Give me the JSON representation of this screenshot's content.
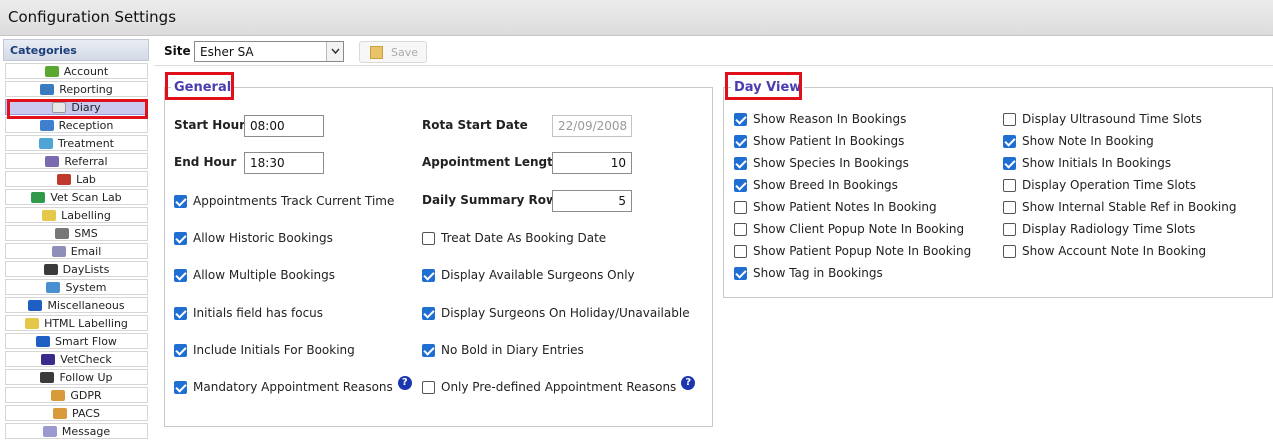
{
  "window": {
    "title": "Configuration Settings"
  },
  "categories": {
    "header": "Categories",
    "items": [
      {
        "label": "Account",
        "icon": "account-icon",
        "color": "#5aa832"
      },
      {
        "label": "Reporting",
        "icon": "reporting-icon",
        "color": "#3a7abf"
      },
      {
        "label": "Diary",
        "icon": "diary-icon",
        "color": "#e8e8e8",
        "selected": true
      },
      {
        "label": "Reception",
        "icon": "reception-icon",
        "color": "#3f7fd0"
      },
      {
        "label": "Treatment",
        "icon": "treatment-icon",
        "color": "#4fa4d6"
      },
      {
        "label": "Referral",
        "icon": "referral-icon",
        "color": "#7a6ab0"
      },
      {
        "label": "Lab",
        "icon": "lab-icon",
        "color": "#c0392b"
      },
      {
        "label": "Vet Scan Lab",
        "icon": "vetscan-icon",
        "color": "#2e9a4a"
      },
      {
        "label": "Labelling",
        "icon": "labelling-icon",
        "color": "#e5c84a"
      },
      {
        "label": "SMS",
        "icon": "sms-icon",
        "color": "#777777"
      },
      {
        "label": "Email",
        "icon": "email-icon",
        "color": "#8e8eb8"
      },
      {
        "label": "DayLists",
        "icon": "daylists-icon",
        "color": "#3a3a3a"
      },
      {
        "label": "System",
        "icon": "system-icon",
        "color": "#4a8fd0"
      },
      {
        "label": "Miscellaneous",
        "icon": "info-icon",
        "color": "#1f5fc4"
      },
      {
        "label": "HTML Labelling",
        "icon": "html-labelling-icon",
        "color": "#e5c84a"
      },
      {
        "label": "Smart Flow",
        "icon": "smart-flow-icon",
        "color": "#1f5fc4"
      },
      {
        "label": "VetCheck",
        "icon": "vetcheck-icon",
        "color": "#3b2a8a"
      },
      {
        "label": "Follow Up",
        "icon": "follow-up-icon",
        "color": "#3a3a3a"
      },
      {
        "label": "GDPR",
        "icon": "gdpr-icon",
        "color": "#d89a3a"
      },
      {
        "label": "PACS",
        "icon": "pacs-icon",
        "color": "#d89a3a"
      },
      {
        "label": "Message",
        "icon": "message-icon",
        "color": "#9a9ad0"
      }
    ]
  },
  "toolbar": {
    "site_label": "Site",
    "site_value": "Esher SA",
    "save_label": "Save"
  },
  "general": {
    "legend": "General",
    "start_hour_label": "Start Hour",
    "start_hour": "08:00",
    "end_hour_label": "End Hour",
    "end_hour": "18:30",
    "rota_start_label": "Rota Start Date",
    "rota_start": "22/09/2008",
    "appt_length_label": "Appointment Length",
    "appt_length": "10",
    "daily_summary_label": "Daily Summary Row",
    "daily_summary": "5",
    "checks_left": [
      {
        "label": "Appointments Track Current Time",
        "checked": true
      },
      {
        "label": "Allow Historic Bookings",
        "checked": true
      },
      {
        "label": "Allow Multiple Bookings",
        "checked": true
      },
      {
        "label": "Initials field has focus",
        "checked": true
      },
      {
        "label": "Include Initials For Booking",
        "checked": true
      },
      {
        "label": "Mandatory Appointment Reasons",
        "checked": true,
        "help": "?"
      }
    ],
    "checks_right": [
      {
        "label": "Treat Date As Booking Date",
        "checked": false
      },
      {
        "label": "Display Available Surgeons Only",
        "checked": true
      },
      {
        "label": "Display Surgeons On Holiday/Unavailable",
        "checked": true
      },
      {
        "label": "No Bold in Diary Entries",
        "checked": true
      },
      {
        "label": "Only Pre-defined Appointment Reasons",
        "checked": false,
        "help": "?"
      }
    ]
  },
  "dayview": {
    "legend": "Day View",
    "col1": [
      {
        "label": "Show Reason In Bookings",
        "checked": true
      },
      {
        "label": "Show Patient In Bookings",
        "checked": true
      },
      {
        "label": "Show Species In Bookings",
        "checked": true
      },
      {
        "label": "Show Breed In Bookings",
        "checked": true
      },
      {
        "label": "Show Patient Notes In Booking",
        "checked": false
      },
      {
        "label": "Show Client Popup Note In Booking",
        "checked": false
      },
      {
        "label": "Show Patient Popup Note In Booking",
        "checked": false
      },
      {
        "label": "Show Tag in Bookings",
        "checked": true
      }
    ],
    "col2": [
      {
        "label": "Display Ultrasound Time Slots",
        "checked": false
      },
      {
        "label": "Show Note In Booking",
        "checked": true
      },
      {
        "label": "Show Initials In Bookings",
        "checked": true
      },
      {
        "label": "Display Operation Time Slots",
        "checked": false
      },
      {
        "label": "Show Internal Stable Ref in Booking",
        "checked": false
      },
      {
        "label": "Display Radiology Time Slots",
        "checked": false
      },
      {
        "label": "Show Account Note In Booking",
        "checked": false
      }
    ]
  },
  "colors": {
    "accent": "#1e6fd1",
    "highlight": "#e0101a",
    "legend": "#4a3db0",
    "selected": "#c9c9ef"
  }
}
